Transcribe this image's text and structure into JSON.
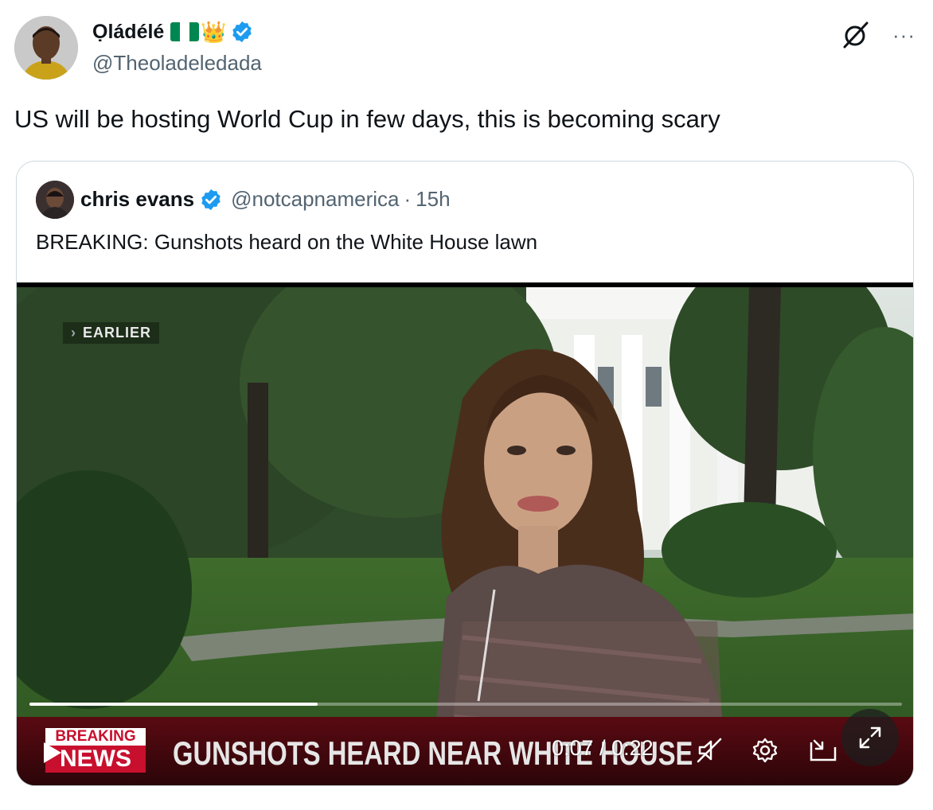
{
  "author": {
    "display_name": "Ọládélé",
    "crown": "👑",
    "handle": "@Theoladeledada"
  },
  "icons": {
    "grok": "grok-icon",
    "more": "···"
  },
  "tweet": {
    "text": "US will be hosting World Cup in few days, this is becoming scary"
  },
  "quoted": {
    "display_name": "chris evans",
    "handle": "@notcapnamerica",
    "separator": "·",
    "time": "15h",
    "text": "BREAKING: Gunshots heard on the White House lawn"
  },
  "video": {
    "earlier_label": "EARLIER",
    "breaking_top": "BREAKING",
    "breaking_bottom": "NEWS",
    "headline": "GUNSHOTS HEARD NEAR WHITE HOUSE",
    "time_display": "0:07 / 0:22",
    "progress": 0.33
  },
  "colors": {
    "verified": "#1d9bf0",
    "flag_green": "#008751",
    "flag_white": "#ffffff",
    "text_secondary": "#536471",
    "border": "#cfd9de"
  }
}
